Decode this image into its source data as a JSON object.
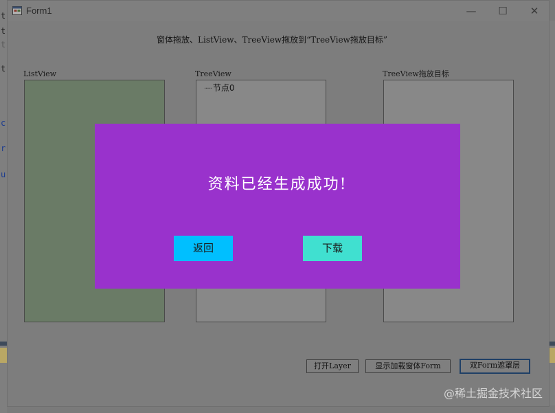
{
  "window": {
    "title": "Form1",
    "controls": {
      "minimize": "—",
      "maximize": "☐",
      "close": "✕"
    }
  },
  "caption": "窗体拖放、ListView、TreeView拖放到“TreeView拖放目标”",
  "panels": {
    "listview_label": "ListView",
    "treeview_label": "TreeView",
    "target_label": "TreeView拖放目标"
  },
  "tree": {
    "node0": "节点0"
  },
  "buttons": {
    "open_layer": "打开Layer",
    "show_load_form": "显示加载窗体Form",
    "double_form_overlay": "双Form遮罩层"
  },
  "popup": {
    "message": "资料已经生成成功!",
    "back_label": "返回",
    "download_label": "下载",
    "background": "#9932cc",
    "back_color": "#00bfff",
    "download_color": "#40e0d0"
  },
  "background_editor": {
    "chars": [
      "t",
      "t",
      "t",
      "t",
      "c",
      "r",
      "u"
    ]
  },
  "watermark": "@稀土掘金技术社区"
}
